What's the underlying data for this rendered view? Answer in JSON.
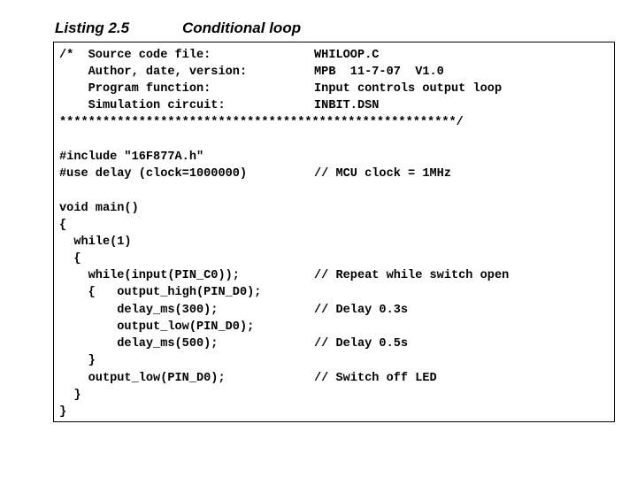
{
  "caption": {
    "number": "Listing 2.5",
    "title": "Conditional loop"
  },
  "lines": [
    {
      "code": "/*  Source code file:",
      "comment": "WHILOOP.C"
    },
    {
      "code": "    Author, date, version:",
      "comment": "MPB  11-7-07  V1.0"
    },
    {
      "code": "    Program function:",
      "comment": "Input controls output loop"
    },
    {
      "code": "    Simulation circuit:",
      "comment": "INBIT.DSN"
    },
    {
      "code": "*******************************************************/",
      "comment": ""
    },
    {
      "code": "",
      "comment": ""
    },
    {
      "code": "#include \"16F877A.h\"",
      "comment": ""
    },
    {
      "code": "#use delay (clock=1000000)",
      "comment": "// MCU clock = 1MHz"
    },
    {
      "code": "",
      "comment": ""
    },
    {
      "code": "void main()",
      "comment": ""
    },
    {
      "code": "{",
      "comment": ""
    },
    {
      "code": "  while(1)",
      "comment": ""
    },
    {
      "code": "  {",
      "comment": ""
    },
    {
      "code": "    while(input(PIN_C0));",
      "comment": "// Repeat while switch open"
    },
    {
      "code": "    {   output_high(PIN_D0);",
      "comment": ""
    },
    {
      "code": "        delay_ms(300);",
      "comment": "// Delay 0.3s"
    },
    {
      "code": "        output_low(PIN_D0);",
      "comment": ""
    },
    {
      "code": "        delay_ms(500);",
      "comment": "// Delay 0.5s"
    },
    {
      "code": "    }",
      "comment": ""
    },
    {
      "code": "    output_low(PIN_D0);",
      "comment": "// Switch off LED"
    },
    {
      "code": "  }",
      "comment": ""
    },
    {
      "code": "}",
      "comment": ""
    }
  ]
}
